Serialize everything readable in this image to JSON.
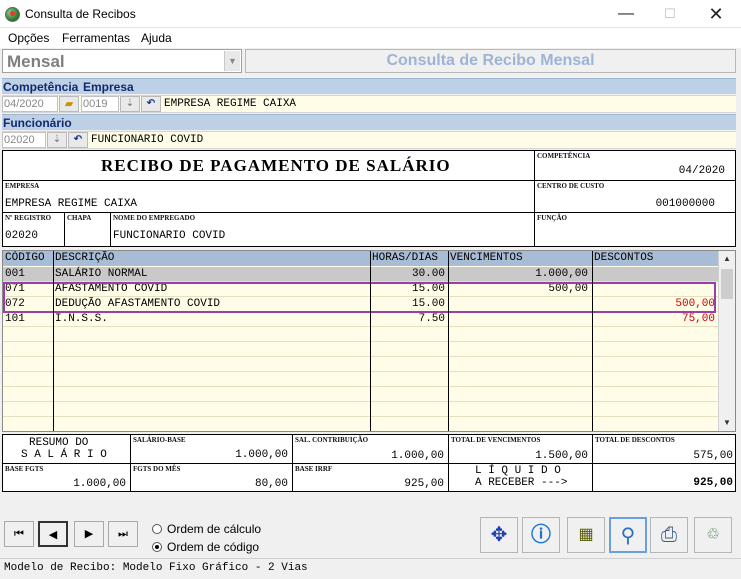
{
  "window": {
    "title": "Consulta de Recibos",
    "minimize": "—",
    "maximize": "☐",
    "close": "✕"
  },
  "menu": [
    "Opções",
    "Ferramentas",
    "Ajuda"
  ],
  "header": {
    "mode_value": "Mensal",
    "title": "Consulta de Recibo Mensal"
  },
  "competencia_section": {
    "label1": "Competência",
    "label2": "Empresa",
    "competencia": "04/2020",
    "empresa_code": "0019",
    "empresa_name": "EMPRESA REGIME CAIXA"
  },
  "funcionario_section": {
    "label": "Funcionário",
    "code": "02020",
    "name": "FUNCIONARIO COVID"
  },
  "receipt": {
    "title": "RECIBO DE PAGAMENTO DE SALÁRIO",
    "competencia_label": "COMPETÊNCIA",
    "competencia": "04/2020",
    "empresa_label": "EMPRESA",
    "empresa": "EMPRESA REGIME CAIXA",
    "centro_label": "CENTRO DE CUSTO",
    "centro": "001000000",
    "registro_label": "Nº REGISTRO",
    "registro": "02020",
    "chapa_label": "CHAPA",
    "nome_label": "NOME DO EMPREGADO",
    "nome": "FUNCIONARIO COVID",
    "funcao_label": "FUNÇÃO"
  },
  "grid": {
    "columns": [
      "CÓDIGO",
      "DESCRIÇÃO",
      "HORAS/DIAS",
      "VENCIMENTOS",
      "DESCONTOS"
    ],
    "rows": [
      {
        "codigo": "001",
        "descricao": "SALÁRIO NORMAL",
        "horas": "30.00",
        "vencimentos": "1.000,00",
        "descontos": ""
      },
      {
        "codigo": "071",
        "descricao": "AFASTAMENTO COVID",
        "horas": "15.00",
        "vencimentos": "500,00",
        "descontos": ""
      },
      {
        "codigo": "072",
        "descricao": "DEDUÇÃO AFASTAMENTO COVID",
        "horas": "15.00",
        "vencimentos": "",
        "descontos": "500,00"
      },
      {
        "codigo": "101",
        "descricao": "I.N.S.S.",
        "horas": "7.50",
        "vencimentos": "",
        "descontos": "75,00"
      }
    ],
    "selected_rows": [
      1,
      2
    ],
    "colors": {
      "header": "#a8bcd6",
      "row_bg": "#fffde7",
      "selected": "#c9c9c9",
      "highlight": "#9b3fa8",
      "discount": "#d00000"
    }
  },
  "summary": {
    "resumo_line1": "RESUMO DO",
    "resumo_line2": "S A L Á R I O",
    "salario_base_label": "SALÁRIO-BASE",
    "salario_base": "1.000,00",
    "sal_contrib_label": "SAL. CONTRIBUIÇÃO",
    "sal_contrib": "1.000,00",
    "total_venc_label": "TOTAL DE VENCIMENTOS",
    "total_venc": "1.500,00",
    "total_desc_label": "TOTAL DE DESCONTOS",
    "total_desc": "575,00",
    "base_fgts_label": "BASE FGTS",
    "base_fgts": "1.000,00",
    "fgts_mes_label": "FGTS DO MÊS",
    "fgts_mes": "80,00",
    "base_irrf_label": "BASE IRRF",
    "base_irrf": "925,00",
    "liquido_line1": "L Í Q U I D O",
    "liquido_line2": "A RECEBER --->",
    "liquido": "925,00"
  },
  "navigation": {
    "first": "⏮",
    "prev": "◀",
    "next": "▶",
    "last": "⏭"
  },
  "ordering": {
    "option1": "Ordem de cálculo",
    "option2": "Ordem de código",
    "selected": "Ordem de código"
  },
  "status": "Modelo de Recibo: Modelo Fixo Gráfico - 2 Vias"
}
